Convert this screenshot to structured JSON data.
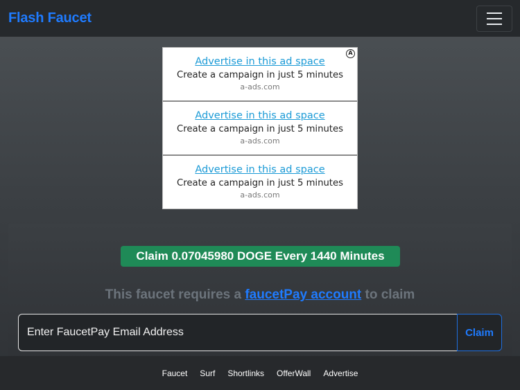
{
  "navbar": {
    "brand": "Flash Faucet",
    "menu_icon": "hamburger-menu-icon",
    "brand_color": "#1f7bff"
  },
  "ads": [
    {
      "title": "Advertise in this ad space",
      "text": "Create a campaign in just 5 minutes",
      "domain": "a-ads.com"
    },
    {
      "title": "Advertise in this ad space",
      "text": "Create a campaign in just 5 minutes",
      "domain": "a-ads.com"
    },
    {
      "title": "Advertise in this ad space",
      "text": "Create a campaign in just 5 minutes",
      "domain": "a-ads.com"
    }
  ],
  "adchoice_label": "A",
  "claim_badge": "Claim 0.07045980 DOGE Every 1440 Minutes",
  "requires": {
    "before": "This faucet requires a",
    "link": "faucetPay account",
    "after": "to claim"
  },
  "form": {
    "email_placeholder": "Enter FaucetPay Email Address",
    "claim_label": "Claim"
  },
  "footer": {
    "links": [
      "Faucet",
      "Surf",
      "Shortlinks",
      "OfferWall",
      "Advertise"
    ]
  },
  "colors": {
    "accent": "#1f7bff",
    "badge": "#1f8a57",
    "navbar": "#26292c"
  }
}
